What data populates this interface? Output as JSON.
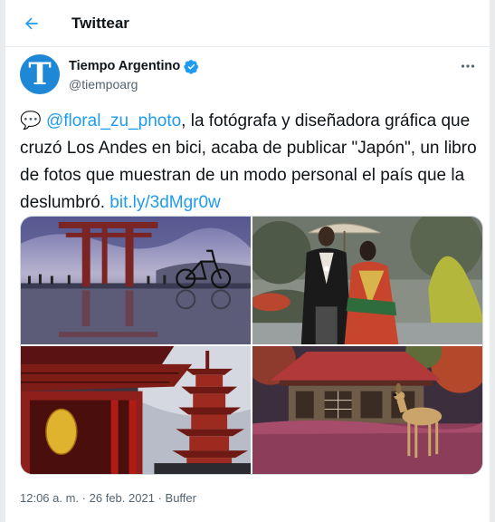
{
  "header": {
    "title": "Twittear"
  },
  "author": {
    "name": "Tiempo Argentino",
    "handle": "@tiempoarg",
    "avatar_letter": "T",
    "verified": true
  },
  "tweet": {
    "emoji": "💬",
    "mention": "@floral_zu_photo",
    "text": ", la fotógrafa y diseñadora gráfica que cruzó Los Andes en bici,  acaba de publicar \"Japón\", un libro de fotos que muestran de un modo personal el país que la deslumbró.",
    "link": "bit.ly/3dMgr0w"
  },
  "media": {
    "photos": [
      "torii-bicycle-photo",
      "wedding-couple-photo",
      "temple-pagoda-photo",
      "deer-autumn-photo"
    ]
  },
  "meta": {
    "time": "12:06 a. m.",
    "separator1": "·",
    "date": "26 feb. 2021",
    "separator2": "·",
    "source": "Buffer"
  },
  "colors": {
    "accent": "#1d9bf0",
    "text": "#0f1419",
    "secondary": "#536471",
    "border": "#cfd9de"
  }
}
